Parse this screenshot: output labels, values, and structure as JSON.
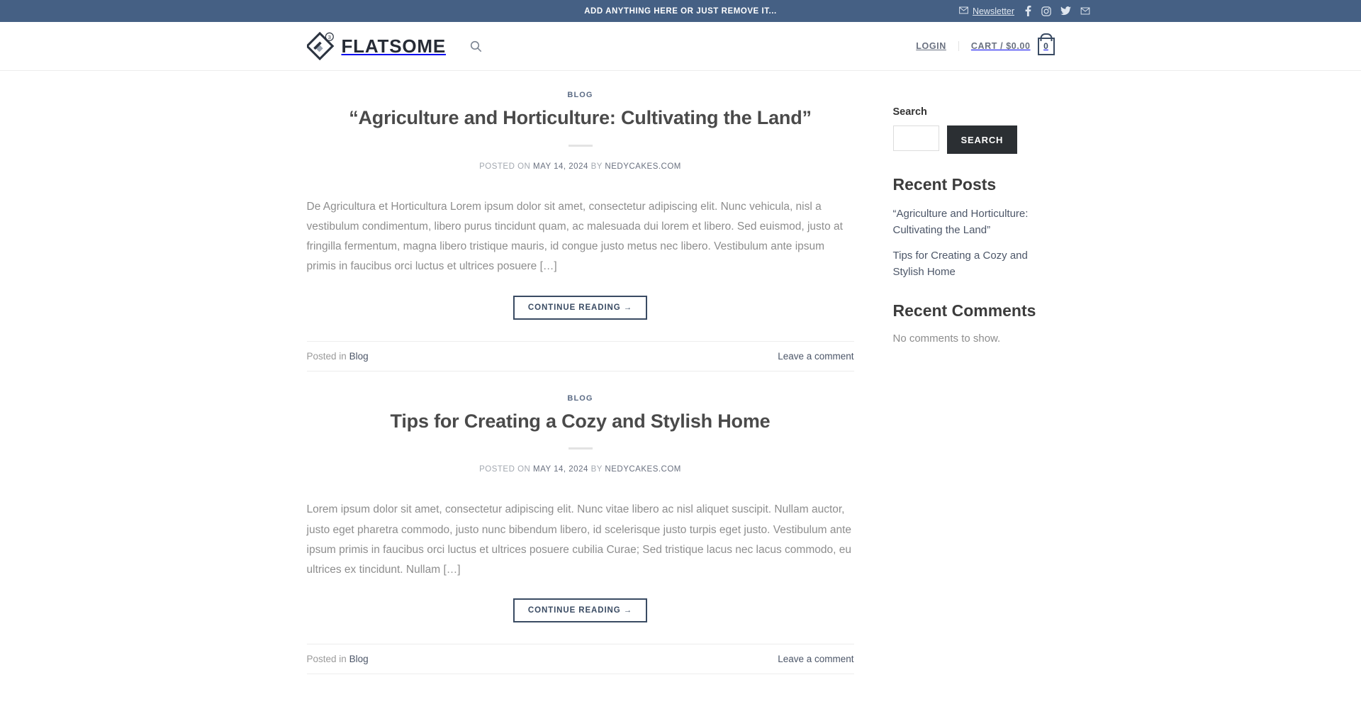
{
  "topbar": {
    "banner_text": "ADD ANYTHING HERE OR JUST REMOVE IT...",
    "newsletter_label": "Newsletter",
    "newsletter_icon": "envelope-icon",
    "social": [
      {
        "name": "facebook-icon",
        "label": "Facebook"
      },
      {
        "name": "instagram-icon",
        "label": "Instagram"
      },
      {
        "name": "twitter-icon",
        "label": "Twitter"
      },
      {
        "name": "email-icon",
        "label": "Email"
      }
    ],
    "background_color": "#456084"
  },
  "header": {
    "logo_text": "FLATSOME",
    "logo_badge": "3",
    "search_icon": "search-icon",
    "login_label": "LOGIN",
    "cart_label": "CART / $0.00",
    "cart_count": "0",
    "cart_icon": "shopping-bag-icon"
  },
  "posts": [
    {
      "category": "BLOG",
      "title": "“Agriculture and Horticulture: Cultivating the Land”",
      "meta_prefix": "POSTED ON",
      "date": "MAY 14, 2024",
      "meta_by": "BY",
      "author": "NEDYCAKES.COM",
      "excerpt": "De Agricultura et Horticultura Lorem ipsum dolor sit amet, consectetur adipiscing elit. Nunc vehicula, nisl a vestibulum condimentum, libero purus tincidunt quam, ac malesuada dui lorem et libero. Sed euismod, justo at fringilla fermentum, magna libero tristique mauris, id congue justo metus nec libero. Vestibulum ante ipsum primis in faucibus orci luctus et ultrices posuere […]",
      "button_label": "CONTINUE READING →",
      "posted_in_prefix": "Posted in",
      "posted_in_term": "Blog",
      "comment_link": "Leave a comment"
    },
    {
      "category": "BLOG",
      "title": "Tips for Creating a Cozy and Stylish Home",
      "meta_prefix": "POSTED ON",
      "date": "MAY 14, 2024",
      "meta_by": "BY",
      "author": "NEDYCAKES.COM",
      "excerpt": "Lorem ipsum dolor sit amet, consectetur adipiscing elit. Nunc vitae libero ac nisl aliquet suscipit. Nullam auctor, justo eget pharetra commodo, justo nunc bibendum libero, id scelerisque justo turpis eget justo. Vestibulum ante ipsum primis in faucibus orci luctus et ultrices posuere cubilia Curae; Sed tristique lacus nec lacus commodo, eu ultrices ex tincidunt. Nullam […]",
      "button_label": "CONTINUE READING →",
      "posted_in_prefix": "Posted in",
      "posted_in_term": "Blog",
      "comment_link": "Leave a comment"
    }
  ],
  "sidebar": {
    "search_widget": {
      "label": "Search",
      "input_value": "",
      "input_placeholder": "",
      "button_label": "SEARCH"
    },
    "recent_posts": {
      "title": "Recent Posts",
      "items": [
        "“Agriculture and Horticulture: Cultivating the Land”",
        "Tips for Creating a Cozy and Stylish Home"
      ]
    },
    "recent_comments": {
      "title": "Recent Comments",
      "empty_text": "No comments to show."
    }
  }
}
